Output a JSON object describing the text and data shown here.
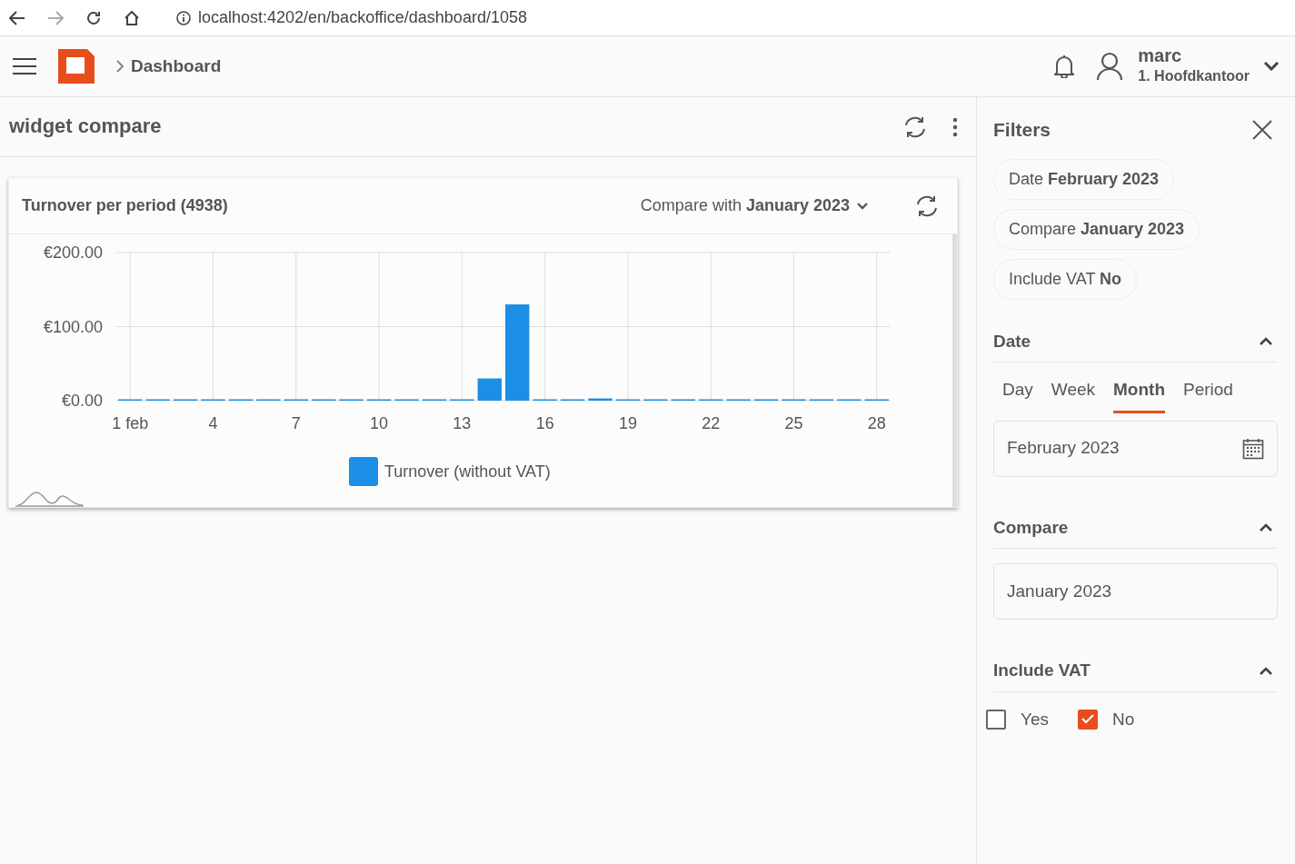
{
  "browser": {
    "url": "localhost:4202/en/backoffice/dashboard/1058"
  },
  "header": {
    "breadcrumb": "Dashboard",
    "user": {
      "name": "marc",
      "location": "1. Hoofdkantoor"
    }
  },
  "page": {
    "title": "widget compare"
  },
  "widget": {
    "title": "Turnover per period (4938)",
    "compare_label": "Compare with **January 2023**",
    "chart_data": {
      "type": "bar",
      "x": [
        1,
        2,
        3,
        4,
        5,
        6,
        7,
        8,
        9,
        10,
        11,
        12,
        13,
        14,
        15,
        16,
        17,
        18,
        19,
        20,
        21,
        22,
        23,
        24,
        25,
        26,
        27,
        28
      ],
      "series": [
        {
          "name": "Turnover (without VAT)",
          "color": "#1b8fe6",
          "values": [
            0,
            0,
            0,
            0,
            0,
            0,
            0,
            0,
            0,
            0,
            0,
            0,
            0,
            30,
            130,
            0,
            0,
            3,
            0,
            0,
            0,
            0,
            0,
            0,
            0,
            0,
            0,
            0
          ]
        }
      ],
      "grid": true,
      "xlim": [
        0.5,
        28.5
      ],
      "ylim": [
        0,
        200
      ],
      "yticks": [
        {
          "value": 0,
          "label": "€0.00"
        },
        {
          "value": 100,
          "label": "€100.00"
        },
        {
          "value": 200,
          "label": "€200.00"
        }
      ],
      "xticks": [
        {
          "value": 1,
          "label": "1 feb"
        },
        4,
        7,
        10,
        13,
        16,
        19,
        22,
        25,
        28
      ]
    }
  },
  "filters": {
    "title": "Filters",
    "chips": [
      "Date **February 2023**",
      "Compare **January 2023**",
      "Include VAT **No**"
    ],
    "sections": [
      {
        "kind": "date",
        "title": "Date",
        "expanded": true,
        "tabs": [
          {
            "label": "Day",
            "selected": false
          },
          {
            "label": "Week",
            "selected": false
          },
          {
            "label": "Month",
            "selected": true
          },
          {
            "label": "Period",
            "selected": false
          }
        ],
        "value": "February 2023"
      },
      {
        "kind": "compare",
        "title": "Compare",
        "expanded": true,
        "value": "January 2023"
      },
      {
        "kind": "checks",
        "title": "Include VAT",
        "expanded": true,
        "options": [
          {
            "label": "Yes",
            "checked": false
          },
          {
            "label": "No",
            "checked": true
          }
        ]
      }
    ]
  }
}
